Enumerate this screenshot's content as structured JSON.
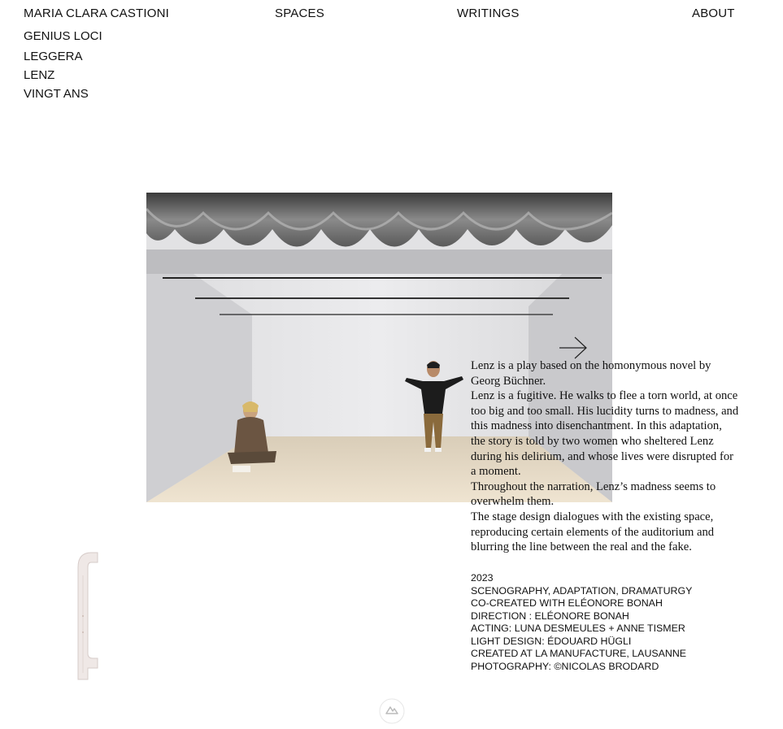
{
  "nav": {
    "home": "MARIA CLARA CASTIONI",
    "spaces": "SPACES",
    "writings": "WRITINGS",
    "about": "ABOUT"
  },
  "projects": [
    "GENIUS LOCI",
    "LEGGERA",
    "LENZ",
    "VINGT ANS"
  ],
  "project": {
    "description": [
      "Lenz is a play based on the homonymous novel by Georg Büchner.",
      "Lenz is a fugitive. He walks to flee a torn world, at once too big and too small. His lucidity turns to madness, and this madness into disenchantment. In this adaptation, the story is told by two women who sheltered Lenz during his delirium, and whose lives were disrupted for a moment.",
      "Throughout the narration, Lenz’s madness seems to overwhelm them.",
      "The stage design dialogues with the existing space, reproducing certain elements of the auditorium and blurring the line between the real and the fake."
    ],
    "credits": [
      "2023",
      "SCENOGRAPHY, ADAPTATION, DRAMATURGY",
      "CO-CREATED WITH ELÉONORE BONAH",
      "DIRECTION : ELÉONORE BONAH",
      "ACTING: LUNA DESMEULES + ANNE TISMER",
      "LIGHT DESIGN: ÉDOUARD HÜGLI",
      "CREATED AT LA MANUFACTURE, LAUSANNE",
      "PHOTOGRAPHY: ©NICOLAS BRODARD"
    ]
  },
  "icons": {
    "next": "arrow-right-icon",
    "logo": "site-logo-icon"
  }
}
